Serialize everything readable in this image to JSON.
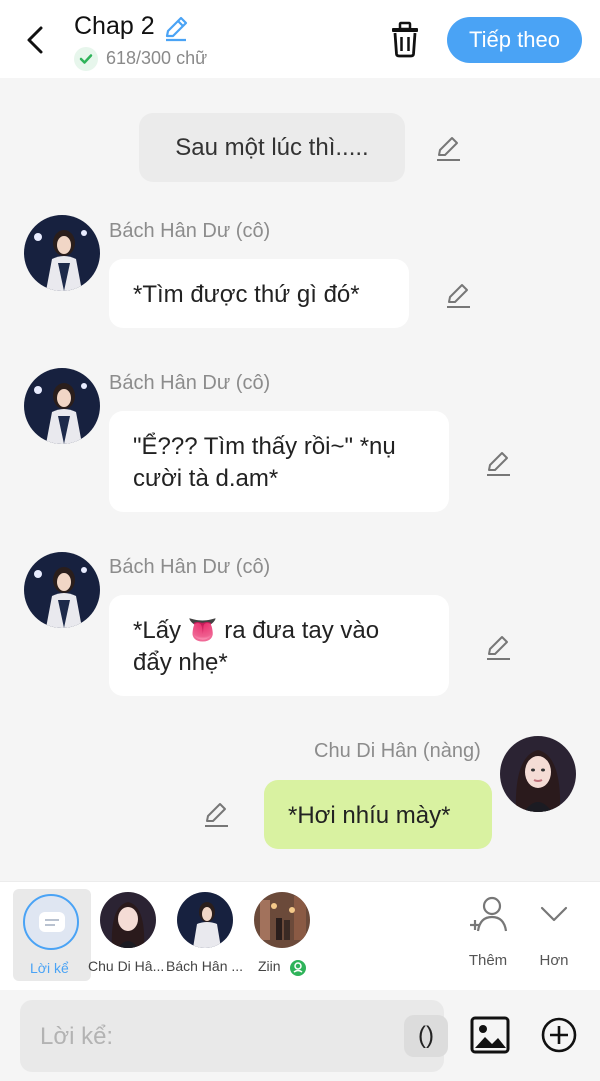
{
  "header": {
    "title": "Chap 2",
    "word_count": "618/300 chữ",
    "next_label": "Tiếp theo"
  },
  "messages": [
    {
      "type": "narration",
      "text": "Sau một lúc thì....."
    },
    {
      "type": "left",
      "name": "Bách Hân Dư (cô)",
      "text": "*Tìm được thứ gì đó*"
    },
    {
      "type": "left",
      "name": "Bách Hân Dư (cô)",
      "text_line1": "\"Ể??? Tìm thấy rồi~\" *nụ",
      "text_line2": "cười tà d.am*"
    },
    {
      "type": "left",
      "name": "Bách Hân Dư (cô)",
      "text_pre": "*Lấy ",
      "emoji": "👅",
      "text_post": " ra đưa tay vào",
      "text_line2": "đẩy nhẹ*"
    },
    {
      "type": "right",
      "name": "Chu Di Hân (nàng)",
      "text": "*Hơi nhíu mày*"
    }
  ],
  "characters": [
    {
      "label": "Lời kể"
    },
    {
      "label": "Chu Di Hâ..."
    },
    {
      "label": "Bách Hân ..."
    },
    {
      "label": "Ziin"
    }
  ],
  "actions": {
    "add_label": "Thêm",
    "more_label": "Hơn"
  },
  "input": {
    "placeholder": "Lời kể:",
    "paren_label": "()"
  },
  "colors": {
    "accent": "#4aa3f5",
    "my_bubble": "#d9f2a1",
    "check": "#2fb35a"
  }
}
